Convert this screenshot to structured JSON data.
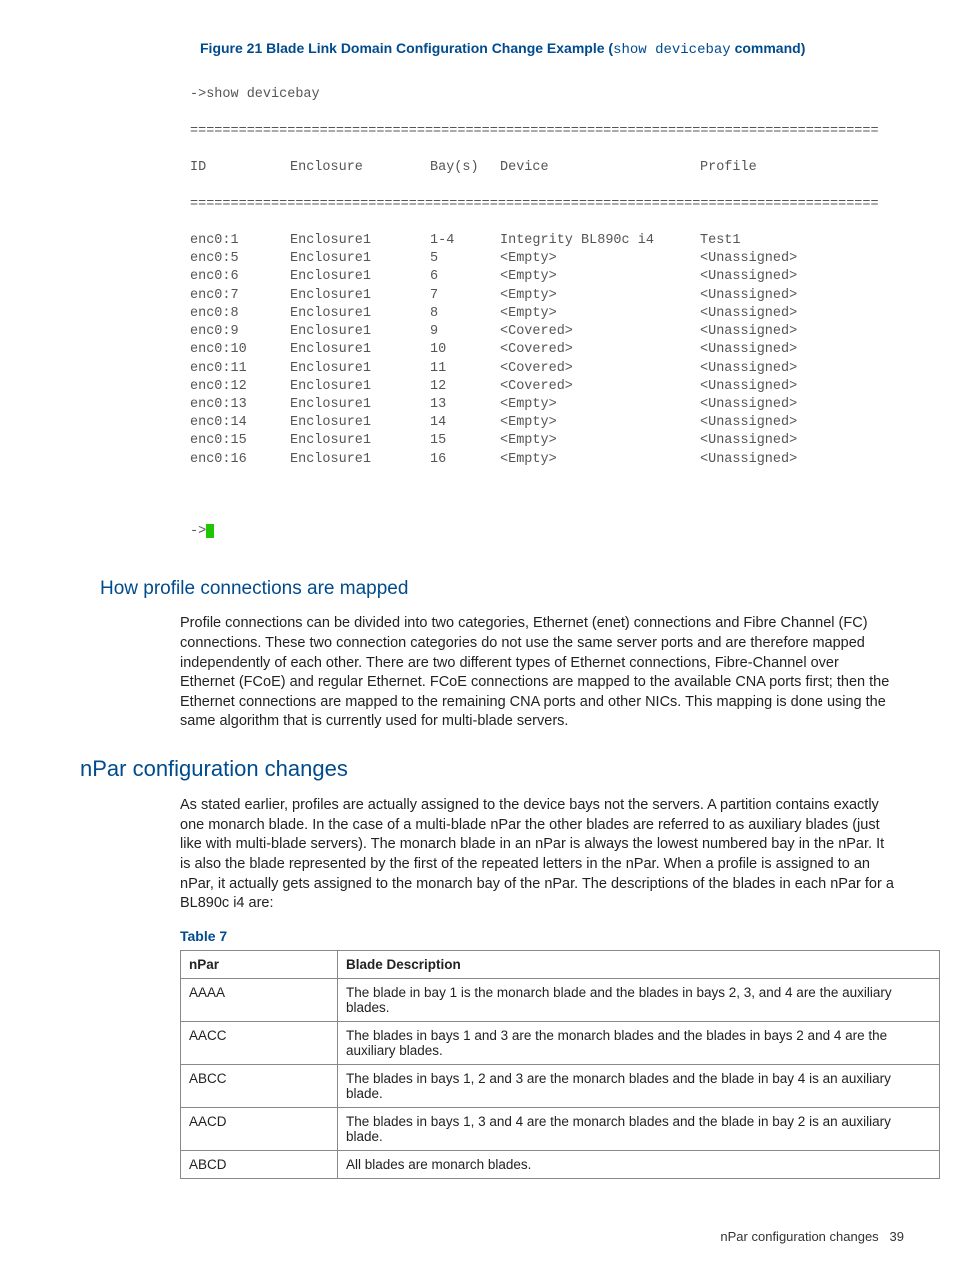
{
  "figure": {
    "label_prefix": "Figure 21 Blade Link Domain Configuration Change Example (",
    "command": "show devicebay",
    "label_suffix": " command)"
  },
  "terminal": {
    "prompt_command": "->show devicebay",
    "divider": "=====================================================================================",
    "headers": {
      "id": "ID",
      "enclosure": "Enclosure",
      "bays": "Bay(s)",
      "device": "Device",
      "profile": "Profile"
    },
    "rows": [
      {
        "id": "enc0:1",
        "enclosure": "Enclosure1",
        "bays": "1-4",
        "device": "Integrity BL890c i4",
        "profile": "Test1"
      },
      {
        "id": "enc0:5",
        "enclosure": "Enclosure1",
        "bays": "5",
        "device": "<Empty>",
        "profile": "<Unassigned>"
      },
      {
        "id": "enc0:6",
        "enclosure": "Enclosure1",
        "bays": "6",
        "device": "<Empty>",
        "profile": "<Unassigned>"
      },
      {
        "id": "enc0:7",
        "enclosure": "Enclosure1",
        "bays": "7",
        "device": "<Empty>",
        "profile": "<Unassigned>"
      },
      {
        "id": "enc0:8",
        "enclosure": "Enclosure1",
        "bays": "8",
        "device": "<Empty>",
        "profile": "<Unassigned>"
      },
      {
        "id": "enc0:9",
        "enclosure": "Enclosure1",
        "bays": "9",
        "device": "<Covered>",
        "profile": "<Unassigned>"
      },
      {
        "id": "enc0:10",
        "enclosure": "Enclosure1",
        "bays": "10",
        "device": "<Covered>",
        "profile": "<Unassigned>"
      },
      {
        "id": "enc0:11",
        "enclosure": "Enclosure1",
        "bays": "11",
        "device": "<Covered>",
        "profile": "<Unassigned>"
      },
      {
        "id": "enc0:12",
        "enclosure": "Enclosure1",
        "bays": "12",
        "device": "<Covered>",
        "profile": "<Unassigned>"
      },
      {
        "id": "enc0:13",
        "enclosure": "Enclosure1",
        "bays": "13",
        "device": "<Empty>",
        "profile": "<Unassigned>"
      },
      {
        "id": "enc0:14",
        "enclosure": "Enclosure1",
        "bays": "14",
        "device": "<Empty>",
        "profile": "<Unassigned>"
      },
      {
        "id": "enc0:15",
        "enclosure": "Enclosure1",
        "bays": "15",
        "device": "<Empty>",
        "profile": "<Unassigned>"
      },
      {
        "id": "enc0:16",
        "enclosure": "Enclosure1",
        "bays": "16",
        "device": "<Empty>",
        "profile": "<Unassigned>"
      }
    ],
    "prompt_end": "->"
  },
  "section1": {
    "heading": "How profile connections are mapped",
    "body": "Profile connections can be divided into two categories, Ethernet (enet) connections and Fibre Channel (FC) connections. These two connection categories do not use the same server ports and are therefore mapped independently of each other. There are two different types of Ethernet connections, Fibre-Channel over Ethernet (FCoE) and regular Ethernet. FCoE connections are mapped to the available CNA ports first; then the Ethernet connections are mapped to the remaining CNA ports and other NICs. This mapping is done using the same algorithm that is currently used for multi-blade servers."
  },
  "section2": {
    "heading": "nPar configuration changes",
    "body": "As stated earlier, profiles are actually assigned to the device bays not the servers. A partition contains exactly one monarch blade. In the case of a multi-blade nPar the other blades are referred to as auxiliary blades (just like with multi-blade servers). The monarch blade in an nPar is always the lowest numbered bay in the nPar. It is also the blade represented by the first of the repeated letters in the nPar. When a profile is assigned to an nPar, it actually gets assigned to the monarch bay of the nPar. The descriptions of the blades in each nPar for a BL890c i4 are:"
  },
  "table": {
    "label": "Table 7",
    "headers": {
      "npar": "nPar",
      "desc": "Blade Description"
    },
    "rows": [
      {
        "npar": "AAAA",
        "desc": "The blade in bay 1 is the monarch blade and the blades in bays 2, 3, and 4 are the auxiliary blades."
      },
      {
        "npar": "AACC",
        "desc": "The blades in bays 1 and 3 are the monarch blades and the blades in bays 2 and 4 are the auxiliary blades."
      },
      {
        "npar": "ABCC",
        "desc": "The blades in bays 1, 2 and 3 are the monarch blades and the blade in bay 4 is an auxiliary blade."
      },
      {
        "npar": "AACD",
        "desc": "The blades in bays 1, 3 and 4 are the monarch blades and the blade in bay 2 is an auxiliary blade."
      },
      {
        "npar": "ABCD",
        "desc": "All blades are monarch blades."
      }
    ]
  },
  "footer": {
    "text": "nPar configuration changes",
    "page": "39"
  }
}
